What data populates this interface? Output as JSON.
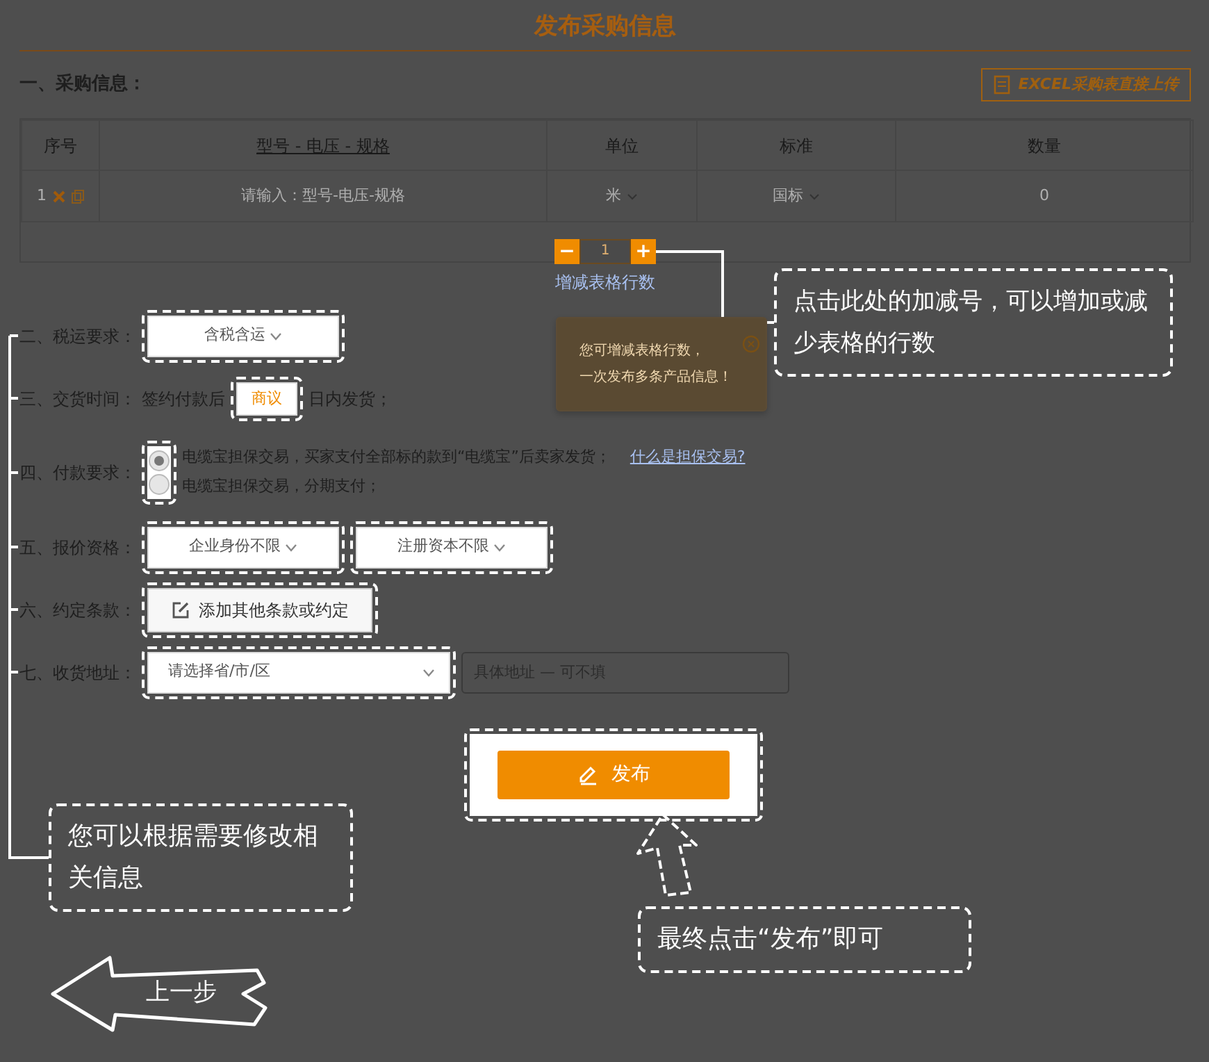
{
  "page_title": "发布采购信息",
  "purchase": {
    "label": "一、采购信息：",
    "upload_button": "EXCEL采购表直接上传",
    "table": {
      "columns": [
        "序号",
        "型号 - 电压 - 规格",
        "单位",
        "标准",
        "数量"
      ],
      "rows": [
        {
          "index": "1",
          "model_placeholder": "请输入：型号-电压-规格",
          "unit": "米",
          "standard": "国标",
          "quantity": "0"
        }
      ]
    },
    "stepper": {
      "minus": "−",
      "value": "1",
      "plus": "+",
      "link": "增减表格行数"
    },
    "hint_popup": {
      "lines": [
        "您可增减表格行数，",
        "一次发布多条产品信息！"
      ]
    }
  },
  "rows": [
    {
      "kind": "plain",
      "label": "二、税运要求：",
      "controls": [
        {
          "kind": "select",
          "value": "含税含运",
          "highlighted": true
        }
      ]
    },
    {
      "kind": "plain",
      "label": "三、交货时间：",
      "prefix": "签约付款后",
      "controls": [
        {
          "kind": "input",
          "value": "商议",
          "highlighted": true
        }
      ],
      "suffix": "日内发货；"
    },
    {
      "kind": "radio",
      "label": "四、付款要求：",
      "highlighted": true,
      "options": [
        {
          "label": "电缆宝担保交易，买家支付全部标的款到“电缆宝”后卖家发货；",
          "selected": true
        },
        {
          "label": "电缆宝担保交易，分期支付；",
          "selected": false
        }
      ],
      "link": "什么是担保交易?"
    },
    {
      "kind": "plain",
      "label": "五、报价资格：",
      "controls": [
        {
          "kind": "select",
          "value": "企业身份不限",
          "highlighted": true
        },
        {
          "kind": "select",
          "value": "注册资本不限",
          "highlighted": true
        }
      ]
    },
    {
      "kind": "plain",
      "label": "六、约定条款：",
      "controls": [
        {
          "kind": "button",
          "value": "添加其他条款或约定",
          "highlighted": true
        }
      ]
    },
    {
      "kind": "address",
      "label": "七、收货地址：",
      "controls": [
        {
          "kind": "select",
          "placeholder": "请选择省/市/区",
          "highlighted": true
        },
        {
          "kind": "input",
          "placeholder": "具体地址 — 可不填",
          "highlighted": false
        }
      ]
    }
  ],
  "publish_button": "发布",
  "callouts": [
    "点击此处的加减号，可以增加或减少表格的行数",
    "您可以根据需要修改相关信息",
    "最终点击“发布”即可"
  ],
  "back_button": "上一步"
}
